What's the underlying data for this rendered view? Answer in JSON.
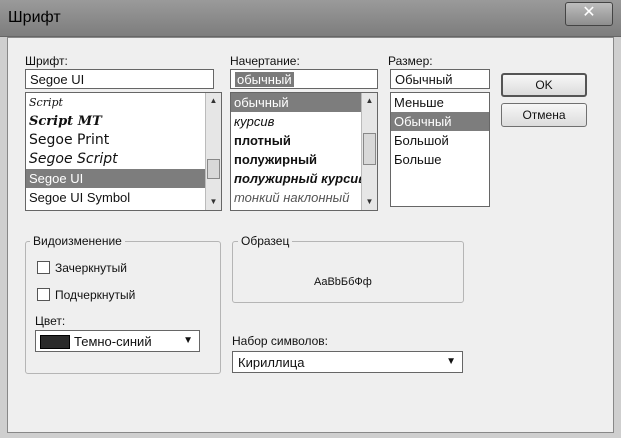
{
  "window": {
    "title": "Шрифт",
    "close_glyph": "✕"
  },
  "font": {
    "label": "Шрифт:",
    "value": "Segoe UI",
    "items": [
      "Script",
      "Script MT",
      "Segoe Print",
      "Segoe Script",
      "Segoe UI",
      "Segoe UI Symbol"
    ],
    "selected_index": 4
  },
  "style": {
    "label": "Начертание:",
    "value": "обычный",
    "items": [
      "обычный",
      "курсив",
      "плотный",
      "полужирный",
      "полужирный курсив",
      "тонкий наклонный"
    ],
    "selected_index": 0
  },
  "size": {
    "label": "Размер:",
    "value": "Обычный",
    "items": [
      "Меньше",
      "Обычный",
      "Большой",
      "Больше"
    ],
    "selected_index": 1
  },
  "buttons": {
    "ok": "OK",
    "cancel": "Отмена"
  },
  "effects": {
    "group_title": "Видоизменение",
    "strikeout": "Зачеркнутый",
    "underline": "Подчеркнутый",
    "color_label": "Цвет:",
    "color_value": "Темно-синий",
    "color_swatch": "#2a2a2a"
  },
  "sample": {
    "group_title": "Образец",
    "text": "AaBbБбФф"
  },
  "charset": {
    "label": "Набор символов:",
    "value": "Кириллица"
  }
}
